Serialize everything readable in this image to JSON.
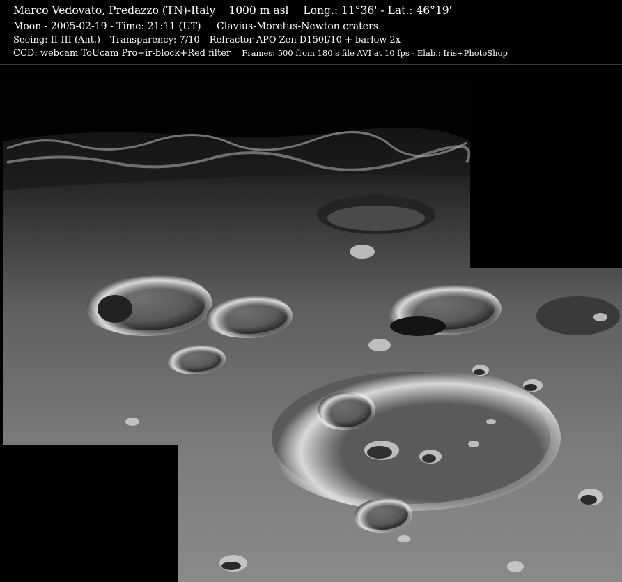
{
  "header": {
    "line1": {
      "author": "Marco Vedovato, Predazzo (TN)-Italy",
      "altitude": "1000 m asl",
      "coords": "Long.: 11°36' - Lat.: 46°19'"
    },
    "line2": {
      "date": "Moon - 2005-02-19 - Time: 21:11 (UT)",
      "target": "Clavius-Moretus-Newton craters"
    },
    "line3": {
      "seeing": "Seeing: II-III (Ant.)",
      "transparency": "Transparency: 7/10",
      "telescope": "Refractor APO Zen D150f/10 + barlow 2x"
    },
    "line4": {
      "ccd": "CCD: webcam ToUcam Pro+ir-block+Red filter",
      "frames": "Frames: 500 from 180 s file AVI at 10 fps - Elab.: Iris+PhotoShop"
    }
  },
  "colors": {
    "background": "#000000",
    "text": "#ffffff",
    "surface_light": "#9a9a9a",
    "surface_dark": "#3c3c3c"
  }
}
